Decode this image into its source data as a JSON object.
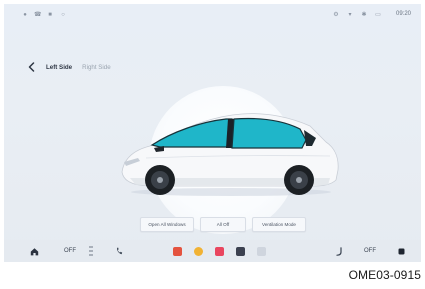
{
  "tabs": {
    "left_side": "Left Side",
    "right_side": "Right Side"
  },
  "buttons": {
    "open_all_windows": "Open All Windows",
    "all_off": "All Off",
    "ventilation_mode": "Ventilation Mode"
  },
  "status_bar": {
    "left_icons": [
      "wifi-icon",
      "phone-icon",
      "card-icon",
      "chat-icon"
    ],
    "right_icons": [
      "settings-icon",
      "signal-icon",
      "bluetooth-icon",
      "battery-icon"
    ],
    "right_text": "09:20"
  },
  "dock": {
    "left_temp": "OFF",
    "right_temp": "OFF",
    "apps": [
      {
        "name": "gallery-app",
        "color": "#e4533f"
      },
      {
        "name": "navigation-app",
        "color": "#f1b234"
      },
      {
        "name": "media-app",
        "color": "#e9465f"
      },
      {
        "name": "settings-app",
        "color": "#3c4150"
      },
      {
        "name": "files-app",
        "color": "#cfd5de"
      }
    ]
  },
  "colors": {
    "window_tint": "#1fb6c9",
    "accent": "#2c3340"
  },
  "caption": "OME03-0915"
}
